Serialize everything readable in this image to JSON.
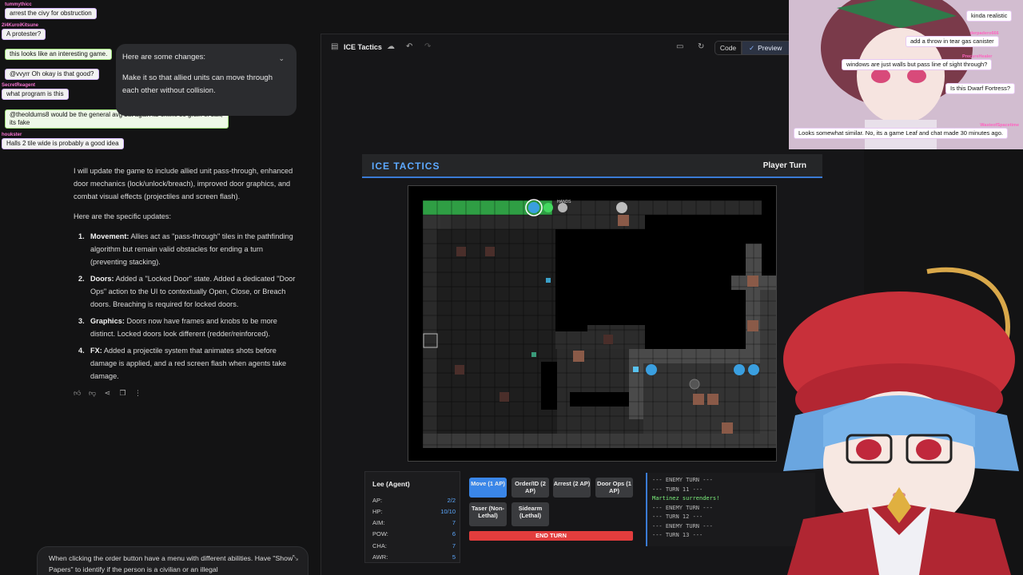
{
  "chat_overlay": [
    {
      "user": "tummythicc",
      "text": "arrest the civy for obstruction"
    },
    {
      "user": "2l4KuroiKitsune",
      "text": "A protester?"
    },
    {
      "user": "",
      "text": "this looks like an interesting game."
    },
    {
      "user": "",
      "text": "@vvyrr Oh okay is that good?"
    },
    {
      "user": "SecretReagent",
      "text": "what program is this"
    },
    {
      "user": "",
      "text": "@theoldums8 would be the general avg but again its online so grain of salt, its fake"
    },
    {
      "user": "houkster",
      "text": "Halls 2 tile wide is probably a good idea"
    }
  ],
  "conversation": {
    "user_prompt_title": "Here are some changes:",
    "user_prompt_body": "Make it so that allied units can move through each other without collision.",
    "response_intro": "I will update the game to include allied unit pass-through, enhanced door mechanics (lock/unlock/breach), improved door graphics, and combat visual effects (projectiles and screen flash).",
    "updates_heading": "Here are the specific updates:",
    "updates": [
      {
        "num": "1.",
        "title": "Movement:",
        "text": "Allies act as \"pass-through\" tiles in the pathfinding algorithm but remain valid obstacles for ending a turn (preventing stacking)."
      },
      {
        "num": "2.",
        "title": "Doors:",
        "text": "Added a \"Locked Door\" state. Added a dedicated \"Door Ops\" action to the UI to contextually Open, Close, or Breach doors. Breaching is required for locked doors."
      },
      {
        "num": "3.",
        "title": "Graphics:",
        "text": "Doors now have frames and knobs to be more distinct. Locked doors look different (redder/reinforced)."
      },
      {
        "num": "4.",
        "title": "FX:",
        "text": "Added a projectile system that animates shots before damage is applied, and a red screen flash when agents take damage."
      }
    ],
    "input_text": "When clicking the order button have a menu with different abilities. Have \"Show Papers\" to identify if the person is a civilian or an illegal"
  },
  "canvas_toolbar": {
    "title": "ICE Tactics",
    "code_label": "Code",
    "preview_label": "Preview"
  },
  "game": {
    "title": "ICE TACTICS",
    "turn_label": "Player Turn",
    "unit_name": "Lee (Agent)",
    "stats": [
      {
        "label": "AP:",
        "value": "2/2"
      },
      {
        "label": "HP:",
        "value": "10/10"
      },
      {
        "label": "AIM:",
        "value": "7"
      },
      {
        "label": "POW:",
        "value": "6"
      },
      {
        "label": "CHA:",
        "value": "7"
      },
      {
        "label": "AWR:",
        "value": "5"
      }
    ],
    "actions": [
      {
        "label": "Move (1 AP)",
        "selected": true
      },
      {
        "label": "Order/ID (2 AP)",
        "selected": false
      },
      {
        "label": "Arrest (2 AP)",
        "selected": false
      },
      {
        "label": "Door Ops (1 AP)",
        "selected": false
      },
      {
        "label": "Taser (Non-Lethal)",
        "selected": false
      },
      {
        "label": "Sidearm (Lethal)",
        "selected": false
      }
    ],
    "end_turn_label": "END TURN",
    "log": [
      "--- ENEMY TURN ---",
      "--- TURN 11 ---",
      "Martinez surrenders!",
      "--- ENEMY TURN ---",
      "--- TURN 12 ---",
      "--- ENEMY TURN ---",
      "--- TURN 13 ---"
    ],
    "unit_tag": "HANDS"
  },
  "stream_chat": [
    {
      "user": "",
      "text": "kinda realistic"
    },
    {
      "user": "derpadero666",
      "text": "add a throw in tear gas canister"
    },
    {
      "user": "PrecureHealer",
      "text": "windows are just walls but pass line of sight through?"
    },
    {
      "user": "",
      "text": "Is this Dwarf Fortress?"
    },
    {
      "user": "WasteofSpacetime",
      "text": "Looks somewhat similar. No, its a game Leaf and chat made 30 minutes ago."
    }
  ],
  "colors": {
    "accent_blue": "#3a86e8",
    "end_turn_red": "#e23d3d",
    "log_green": "#7cf07c",
    "path_green": "#2f9e44"
  }
}
